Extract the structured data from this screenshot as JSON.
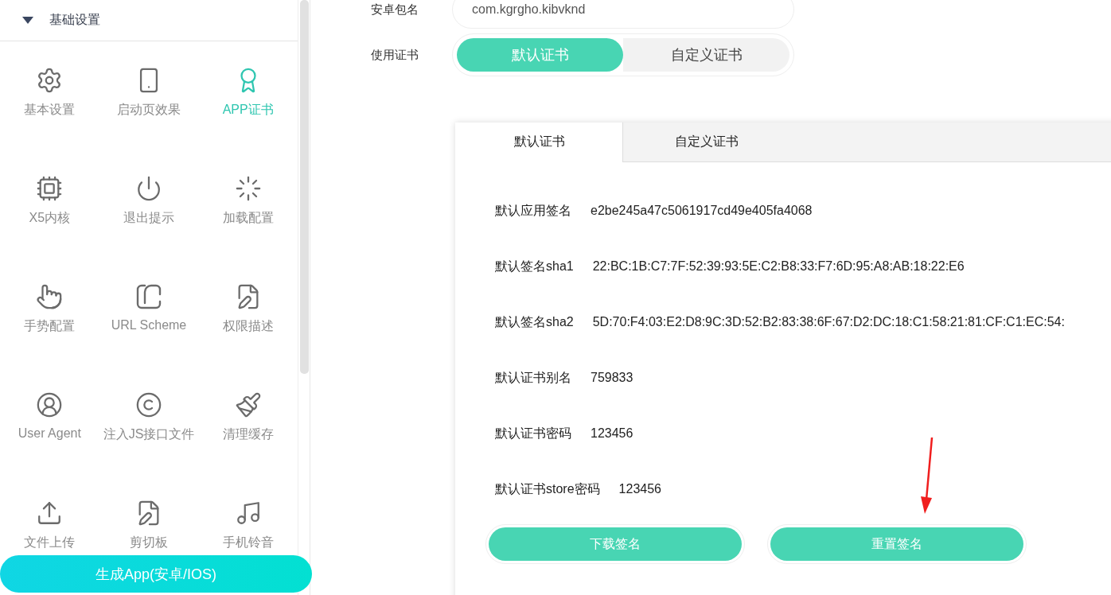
{
  "sidebar": {
    "section": {
      "title": "基础设置",
      "expanded": true
    },
    "items": [
      {
        "label": "基本设置",
        "selected": false
      },
      {
        "label": "启动页效果",
        "selected": false
      },
      {
        "label": "APP证书",
        "selected": true
      },
      {
        "label": "X5内核",
        "selected": false
      },
      {
        "label": "退出提示",
        "selected": false
      },
      {
        "label": "加载配置",
        "selected": false
      },
      {
        "label": "手势配置",
        "selected": false
      },
      {
        "label": "URL Scheme",
        "selected": false
      },
      {
        "label": "权限描述",
        "selected": false
      },
      {
        "label": "User Agent",
        "selected": false
      },
      {
        "label": "注入JS接口文件",
        "selected": false
      },
      {
        "label": "清理缓存",
        "selected": false
      },
      {
        "label": "文件上传",
        "selected": false
      },
      {
        "label": "剪切板",
        "selected": false
      },
      {
        "label": "手机铃音",
        "selected": false
      }
    ],
    "generate_button": "生成App(安卓/IOS)"
  },
  "form": {
    "package": {
      "label": "安卓包名",
      "value": "com.kgrgho.kibvknd"
    },
    "certificate": {
      "label": "使用证书",
      "options": [
        {
          "label": "默认证书",
          "selected": true
        },
        {
          "label": "自定义证书",
          "selected": false
        }
      ]
    }
  },
  "card": {
    "tabs": [
      {
        "label": "默认证书",
        "selected": true
      },
      {
        "label": "自定义证书",
        "selected": false
      }
    ],
    "rows": [
      {
        "label": "默认应用签名",
        "value": "e2be245a47c5061917cd49e405fa4068"
      },
      {
        "label": "默认签名sha1",
        "value": "22:BC:1B:C7:7F:52:39:93:5E:C2:B8:33:F7:6D:95:A8:AB:18:22:E6"
      },
      {
        "label": "默认签名sha2",
        "value": "5D:70:F4:03:E2:D8:9C:3D:52:B2:83:38:6F:67:D2:DC:18:C1:58:21:81:CF:C1:EC:54:"
      },
      {
        "label": "默认证书别名",
        "value": "759833"
      },
      {
        "label": "默认证书密码",
        "value": "123456"
      },
      {
        "label": "默认证书store密码",
        "value": "123456"
      }
    ],
    "buttons": [
      "下载签名",
      "重置签名"
    ]
  }
}
